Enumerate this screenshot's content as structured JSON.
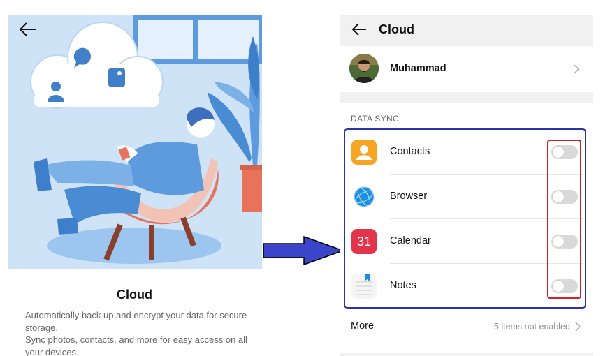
{
  "left": {
    "title": "Cloud",
    "description_line1": "Automatically back up and encrypt your data for secure storage.",
    "description_line2": "Sync photos, contacts, and more for easy access on all your devices."
  },
  "right": {
    "header": {
      "title": "Cloud"
    },
    "account": {
      "name": "Muhammad"
    },
    "data_sync": {
      "label": "DATA SYNC",
      "items": [
        {
          "label": "Contacts",
          "enabled": false
        },
        {
          "label": "Browser",
          "enabled": false
        },
        {
          "label": "Calendar",
          "enabled": false,
          "icon_text": "31"
        },
        {
          "label": "Notes",
          "enabled": false
        }
      ]
    },
    "more": {
      "label": "More",
      "status": "5 items not enabled"
    }
  },
  "colors": {
    "annotation_blue": "#2a33a8",
    "annotation_red": "#d8202a",
    "arrow_fill": "#3b45c9",
    "toggle_off": "#d9d9d9"
  }
}
